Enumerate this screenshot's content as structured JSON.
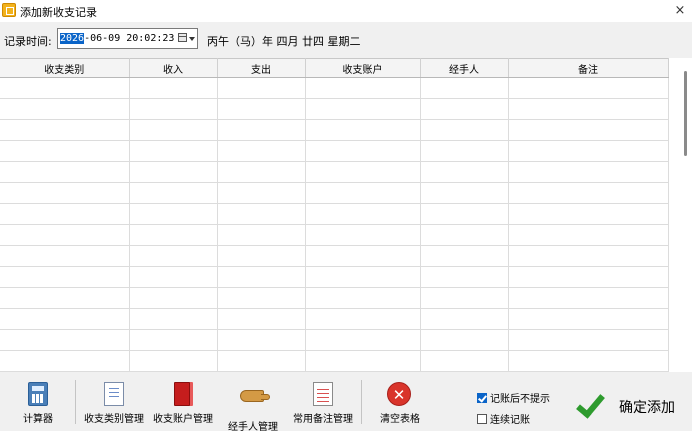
{
  "window": {
    "title": "添加新收支记录",
    "close": "×"
  },
  "record_time": {
    "label": "记录时间:",
    "year_selected": "2026",
    "rest": "-06-09 20:02:23",
    "lunar": "丙午（马）年 四月 廿四 星期二"
  },
  "table": {
    "columns": [
      "收支类别",
      "收入",
      "支出",
      "收支账户",
      "经手人",
      "备注"
    ],
    "empty_rows": 14
  },
  "toolbar": {
    "calculator": "计算器",
    "category_mgmt": "收支类别管理",
    "account_mgmt": "收支账户管理",
    "handler_mgmt": "经手人管理",
    "remark_mgmt": "常用备注管理",
    "clear_table": "清空表格"
  },
  "options": {
    "no_prompt": {
      "label": "记账后不提示",
      "checked": true
    },
    "continuous": {
      "label": "连续记账",
      "checked": false
    }
  },
  "confirm": {
    "label": "确定添加"
  }
}
